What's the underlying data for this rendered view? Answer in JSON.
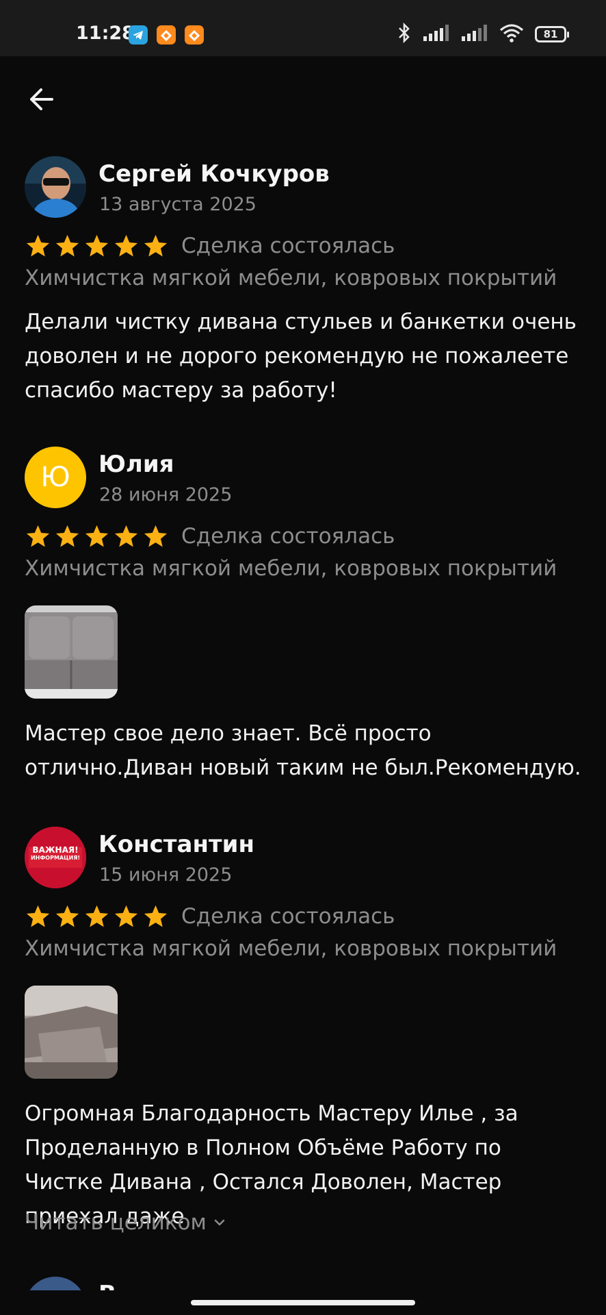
{
  "status_bar": {
    "time": "11:28",
    "battery": "81",
    "app_icons": [
      "telegram-icon",
      "orange-app-icon",
      "orange-app-icon"
    ],
    "indicators": [
      "bluetooth-icon",
      "signal-icon",
      "signal-icon",
      "wifi-icon"
    ]
  },
  "header": {
    "back_icon": "arrow-left-icon"
  },
  "colors": {
    "background": "#0a0a0a",
    "star": "#fbb014",
    "muted_text": "#8d8d8d",
    "avatar_yellow": "#ffc400",
    "avatar_red": "#c8102e"
  },
  "reviews": [
    {
      "author": "Сергей Кочкуров",
      "date": "13 августа 2025",
      "rating": 5,
      "deal_status": "Сделка состоялась",
      "service": "Химчистка мягкой мебели, ковровых покрытий",
      "text": "Делали чистку дивана стульев и банкетки очень доволен и не дорого рекомендую не пожалеете спасибо мастеру за работу!",
      "avatar": "photo-avatar"
    },
    {
      "author": "Юлия",
      "date": "28 июня 2025",
      "rating": 5,
      "deal_status": "Сделка состоялась",
      "service": "Химчистка мягкой мебели, ковровых покрытий",
      "avatar_letter": "Ю",
      "photo": "sofa-photo",
      "text": "Мастер свое дело знает. Всё просто отлично.Диван новый таким не был.Рекомендую."
    },
    {
      "author": "Константин",
      "date": "15 июня 2025",
      "rating": 5,
      "deal_status": "Сделка состоялась",
      "service": "Химчистка мягкой мебели, ковровых покрытий",
      "avatar_logo": {
        "line1": "ВАЖНАЯ!",
        "line2": "ИНФОРМАЦИЯ!"
      },
      "photo": "sofa-photo",
      "text": "Огромная Благодарность Мастеру Илье , за Проделанную в Полном Объёме Работу по Чистке Дивана , Остался Доволен, Мастер приехал даже",
      "read_more": "Читать целиком"
    }
  ],
  "next_review_partial": {
    "author_initial": "В"
  }
}
